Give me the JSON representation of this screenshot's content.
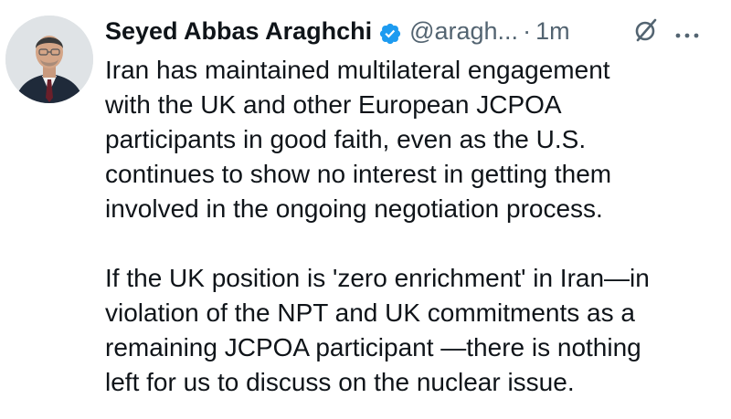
{
  "tweet": {
    "author_name": "Seyed Abbas Araghchi",
    "handle": "@aragh...",
    "separator": "·",
    "time": "1m",
    "paragraphs": [
      "Iran has maintained multilateral engagement\nwith the UK and other European JCPOA\nparticipants in good faith, even as the U.S.\ncontinues to show no interest in getting them\ninvolved in the ongoing negotiation process.",
      "If the UK position is 'zero enrichment' in Iran—in\nviolation of the NPT and UK commitments as a\nremaining JCPOA participant —there is nothing\nleft for us to discuss on the nuclear issue."
    ]
  },
  "icons": {
    "verified": "verified-badge-icon",
    "grok": "grok-icon",
    "more": "more-options-icon"
  },
  "colors": {
    "text_primary": "#0f1419",
    "text_secondary": "#536471",
    "verified_blue": "#1d9bf0"
  }
}
